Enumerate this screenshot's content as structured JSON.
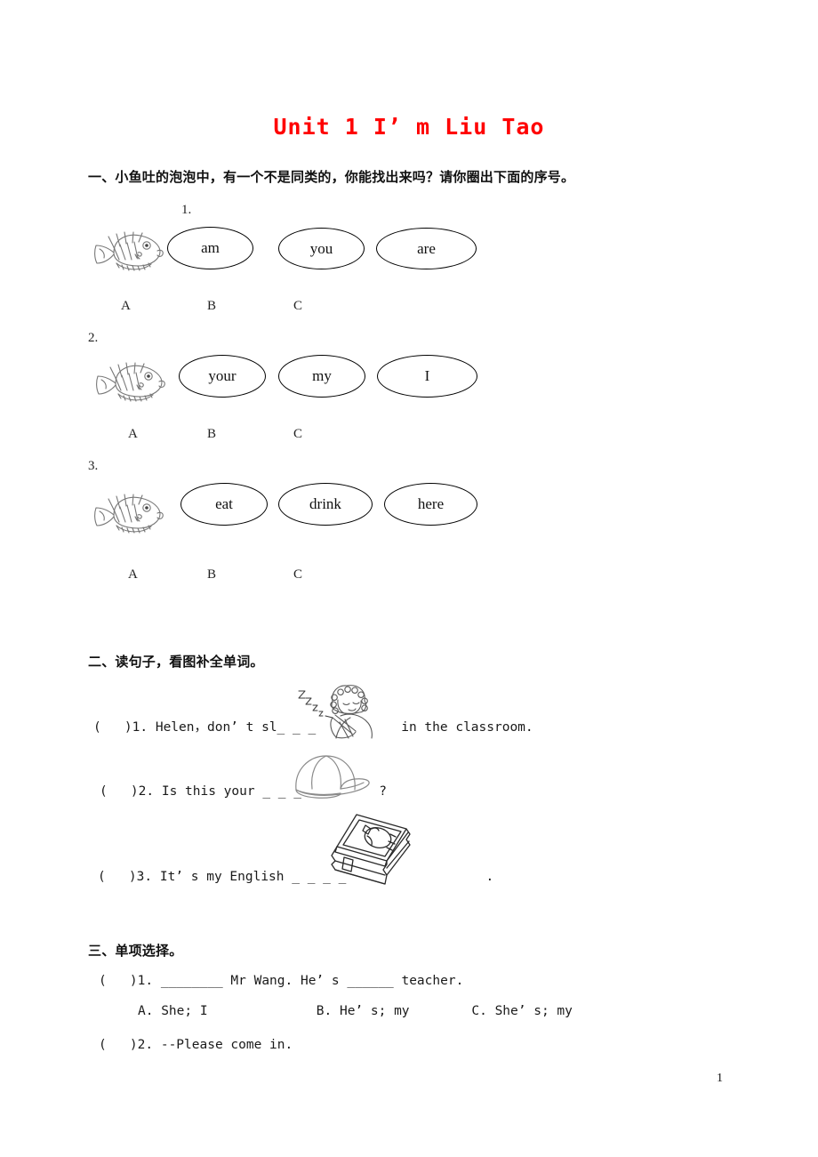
{
  "document": {
    "title": "Unit 1 I’ m Liu Tao",
    "title_color": "#ff0000",
    "page_number": "1"
  },
  "section1": {
    "heading": "一、小鱼吐的泡泡中，有一个不是同类的，你能找出来吗？请你圈出下面的序号。",
    "rows": [
      {
        "number": "1.",
        "fish_icon": "fish-icon",
        "bubbles": [
          "am",
          "you",
          "are"
        ],
        "choice_labels": [
          "A",
          "B",
          "C"
        ]
      },
      {
        "number": "2.",
        "fish_icon": "fish-icon",
        "bubbles": [
          "your",
          "my",
          "I"
        ],
        "choice_labels": [
          "A",
          "B",
          "C"
        ]
      },
      {
        "number": "3.",
        "fish_icon": "fish-icon",
        "bubbles": [
          "eat",
          "drink",
          "here"
        ],
        "choice_labels": [
          "A",
          "B",
          "C"
        ]
      }
    ]
  },
  "section2": {
    "heading": "二、读句子，看图补全单词。",
    "items": [
      {
        "text": "(   )1. Helen，don’ t sl_ _ _           in the classroom.",
        "picture": "sleeping-person-icon"
      },
      {
        "text": "(   )2. Is this your _ _ _          ?",
        "picture": "baseball-cap-icon"
      },
      {
        "text": "(   )3. It’ s my English _ _ _ _                  .",
        "picture": "book-icon"
      }
    ]
  },
  "section3": {
    "heading": "三、单项选择。",
    "items": [
      {
        "text": "(   )1. ________ Mr Wang. He’ s ______ teacher."
      },
      {
        "text": "A. She; I              B. He’ s; my        C. She’ s; my"
      },
      {
        "text": "(   )2. --Please come in."
      }
    ]
  }
}
